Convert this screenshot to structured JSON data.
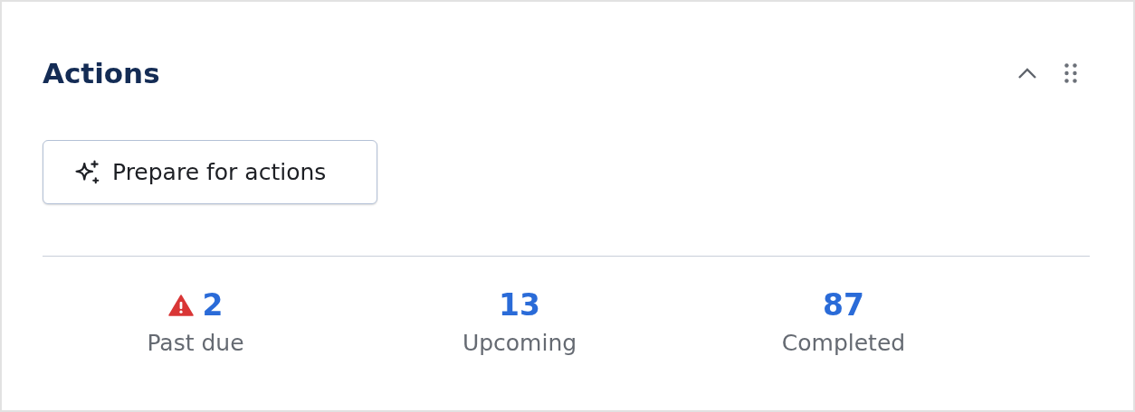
{
  "card": {
    "title": "Actions",
    "expanded": true
  },
  "button": {
    "label": "Prepare for actions"
  },
  "stats": [
    {
      "value": "2",
      "label": "Past due",
      "alert": true
    },
    {
      "value": "13",
      "label": "Upcoming",
      "alert": false
    },
    {
      "value": "87",
      "label": "Completed",
      "alert": false
    }
  ]
}
